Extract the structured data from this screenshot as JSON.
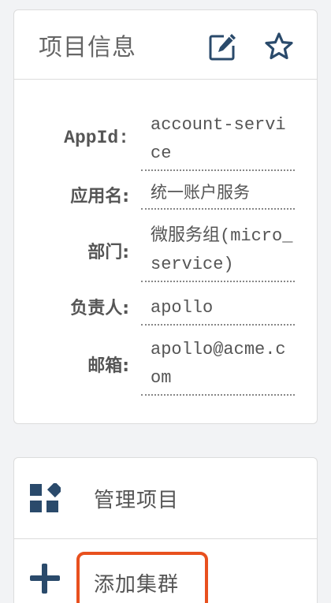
{
  "info_panel": {
    "title": "项目信息",
    "icons": {
      "edit": "edit-icon",
      "star": "star-icon"
    },
    "fields": [
      {
        "label": "AppId:",
        "value": "account-service"
      },
      {
        "label": "应用名:",
        "value": "统一账户服务"
      },
      {
        "label": "部门:",
        "value": "微服务组(micro_service)"
      },
      {
        "label": "负责人:",
        "value": "apollo"
      },
      {
        "label": "邮箱:",
        "value": "apollo@acme.com"
      }
    ]
  },
  "actions": {
    "items": [
      {
        "label": "管理项目",
        "icon": "widgets-icon"
      },
      {
        "label": "添加集群",
        "icon": "plus-icon"
      }
    ]
  },
  "colors": {
    "icon": "#2a4a6b",
    "highlight": "#e8501e",
    "text": "#555555"
  }
}
